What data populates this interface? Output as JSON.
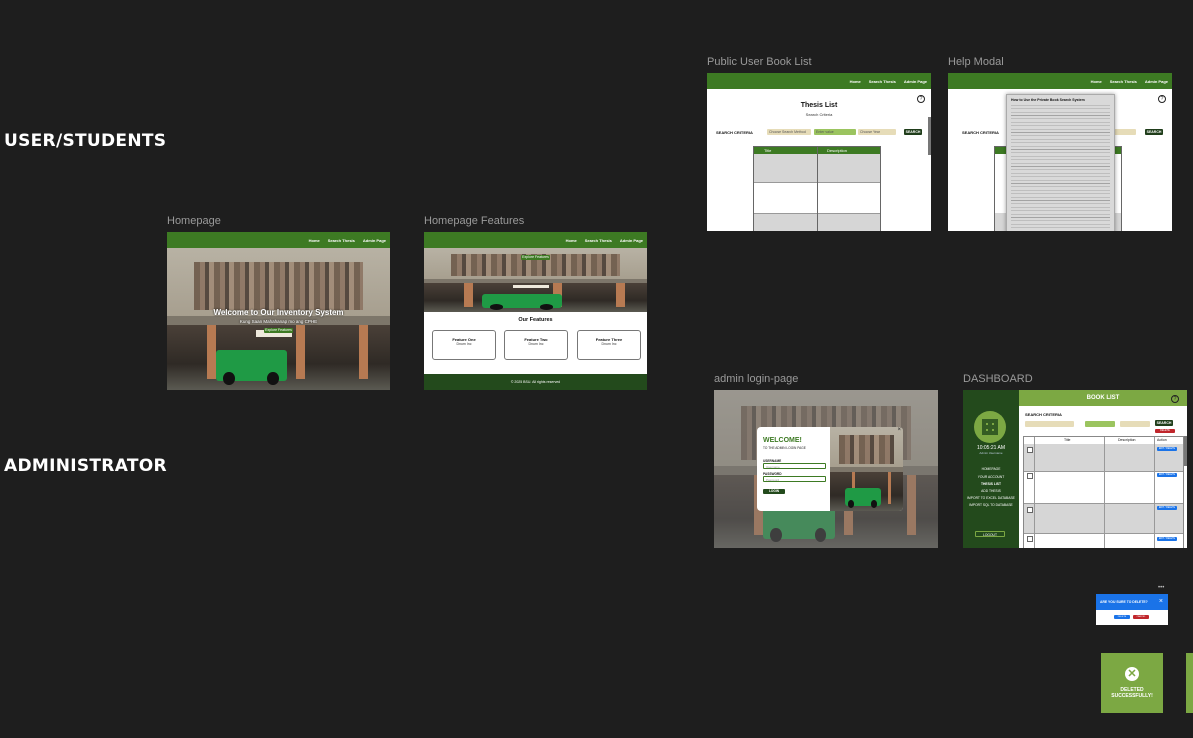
{
  "sections": {
    "user": "USER/STUDENTS",
    "admin": "ADMINISTRATOR"
  },
  "frames": {
    "homepage": {
      "label": "Homepage",
      "nav": [
        "Home",
        "Search Thesis",
        "Admin Page"
      ],
      "hero_title": "Welcome to Our Inventory System",
      "hero_subtitle": "Kung Saan Mahahanap mo ang CPHE",
      "cta": "Explore Features"
    },
    "features": {
      "label": "Homepage Features",
      "nav": [
        "Home",
        "Search Thesis",
        "Admin Page"
      ],
      "cta": "Explore Features",
      "heading": "Our Features",
      "cards": [
        {
          "title": "Feature One",
          "desc": "Dnum Inc"
        },
        {
          "title": "Feature Two",
          "desc": "Dnum Inc"
        },
        {
          "title": "Feature Three",
          "desc": "Dnum Inc"
        }
      ],
      "footer": "© 2025 BSU. All rights reserved"
    },
    "booklist": {
      "label": "Public User Book List",
      "nav": [
        "Home",
        "Search Thesis",
        "Admin Page"
      ],
      "title": "Thesis List",
      "subtitle": "Search Criteria",
      "criteria_label": "SEARCH CRITERIA",
      "fields": [
        "Choose Search Method",
        "Enter value",
        "Choose Year"
      ],
      "search_btn": "SEARCH",
      "columns": [
        "Title",
        "Description"
      ]
    },
    "help": {
      "label": "Help Modal",
      "nav": [
        "Home",
        "Search Thesis",
        "Admin Page"
      ],
      "criteria_label": "SEARCH CRITERIA",
      "search_btn": "SEARCH",
      "modal_title": "How to Use the Private Book Search System"
    },
    "login": {
      "label": "admin login-page",
      "welcome": "WELCOME!",
      "subtitle": "TO THE ADMIN LOGIN PAGE",
      "username_label": "USERNAME",
      "username_placeholder": "Username",
      "password_label": "PASSWORD",
      "password_placeholder": "Password",
      "login_btn": "LOGIN",
      "close": "×"
    },
    "dashboard": {
      "label": "DASHBOARD",
      "time": "10:05:21 AM",
      "role": "Admin Username",
      "menu": [
        "HOMEPAGE",
        "YOUR ACCOUNT",
        "THESIS LIST",
        "ADD THESIS",
        "IMPORT TO EXCEL DATABASE",
        "IMPORT SQL TO DATABASE"
      ],
      "logout": "LOGOUT",
      "header": "BOOK LIST",
      "criteria_label": "SEARCH CRITERIA",
      "search_btn": "SEARCH",
      "delete_btn": "DELETE SELECTED",
      "columns": [
        "Title",
        "Description",
        "Action"
      ],
      "row_btn": "EDIT / DELETE"
    },
    "confirm": {
      "message": "ARE YOU SURE TO DELETE?",
      "yes": "DELETE",
      "no": "CANCEL",
      "close": "×",
      "dots": "•••"
    },
    "toast": {
      "message": "DELETED SUCCESSFULLY!",
      "dots": "•••"
    }
  },
  "colors": {
    "canvas": "#1e1e1e",
    "brand_green": "#3d7a23",
    "dark_green": "#234a1c",
    "toast_green": "#7ca843",
    "alert_blue": "#1a73e8"
  }
}
